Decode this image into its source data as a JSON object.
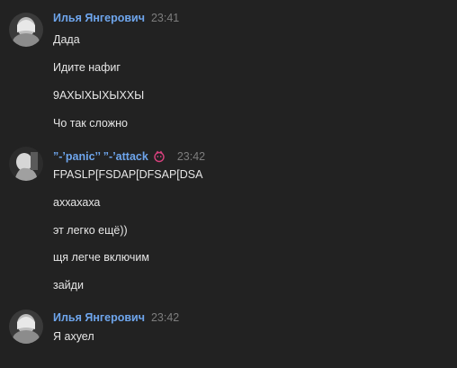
{
  "accent_color": "#6ea5ec",
  "groups": [
    {
      "author": "Илья Янгерович",
      "time": "23:41",
      "messages": [
        "Дада",
        "Идите нафиг",
        "9АХЫХЫХЫХХЫ",
        "Чо так сложно"
      ]
    },
    {
      "author": "”-’panic’’ ”-’attack",
      "time": "23:42",
      "badge": "pink-status-icon",
      "messages": [
        "FPASLP[FSDAP[DFSAP[DSA",
        "аххахаха",
        "эт легко ещё))",
        "щя легче включим",
        "зайди"
      ]
    },
    {
      "author": "Илья Янгерович",
      "time": "23:42",
      "messages": [
        "Я ахуел"
      ]
    }
  ]
}
